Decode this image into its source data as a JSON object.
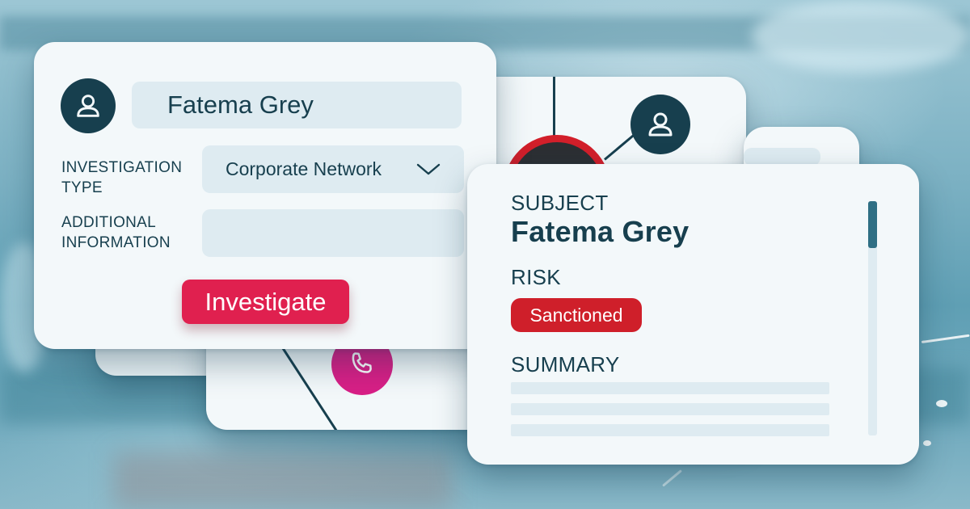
{
  "form": {
    "name_value": "Fatema Grey",
    "investigation_type_label": "INVESTIGATION TYPE",
    "investigation_type_value": "Corporate Network",
    "additional_info_label": "ADDITIONAL INFORMATION",
    "additional_info_value": "",
    "investigate_button": "Investigate"
  },
  "profile": {
    "subject_label": "SUBJECT",
    "subject_name": "Fatema Grey",
    "risk_label": "RISK",
    "risk_badge": "Sanctioned",
    "summary_label": "SUMMARY"
  },
  "colors": {
    "accent": "#e0204f",
    "sanctioned_badge": "#cf1f2a",
    "ink": "#173f4e",
    "field_bg": "#deebf1",
    "phone_circle": "#d81f86",
    "risk_ring": "#d21f2a"
  },
  "icons": [
    "user-icon",
    "chevron-down-icon",
    "phone-icon"
  ]
}
